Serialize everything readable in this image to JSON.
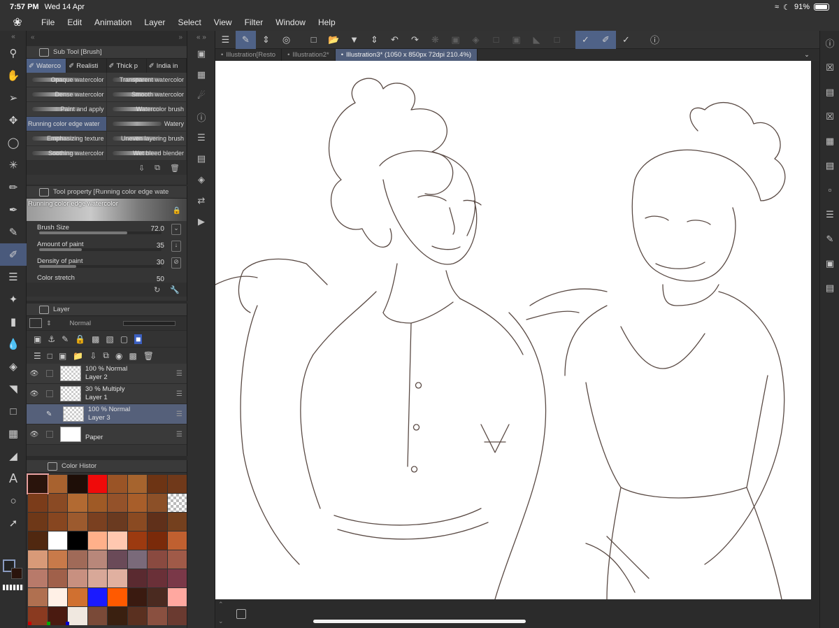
{
  "status": {
    "time": "7:57 PM",
    "date": "Wed 14 Apr",
    "battery": "91%"
  },
  "menu": [
    "File",
    "Edit",
    "Animation",
    "Layer",
    "Select",
    "View",
    "Filter",
    "Window",
    "Help"
  ],
  "subtool": {
    "panel_title": "Sub Tool [Brush]",
    "tabs": [
      {
        "label": "Waterco",
        "active": true
      },
      {
        "label": "Realisti",
        "active": false
      },
      {
        "label": "Thick p",
        "active": false
      },
      {
        "label": "India in",
        "active": false
      }
    ],
    "brushes": [
      {
        "label": "Opaque watercolor",
        "selected": false
      },
      {
        "label": "Transparent watercolor",
        "selected": false
      },
      {
        "label": "Dense watercolor",
        "selected": false
      },
      {
        "label": "Smooth watercolor",
        "selected": false
      },
      {
        "label": "Paint and apply",
        "selected": false
      },
      {
        "label": "Watercolor brush",
        "selected": false
      },
      {
        "label": "Running color edge water",
        "selected": true
      },
      {
        "label": "Watery",
        "selected": false
      },
      {
        "label": "Emphasizing texture",
        "selected": false
      },
      {
        "label": "Uneven layering brush",
        "selected": false
      },
      {
        "label": "Soothing watercolor",
        "selected": false
      },
      {
        "label": "Wet bleed blender",
        "selected": false
      }
    ]
  },
  "toolprop": {
    "panel_title": "Tool property [Running color edge wate",
    "brush_name": "Running color edge watercolor",
    "rows": [
      {
        "label": "Brush Size",
        "value": "72.0",
        "level": 0.72
      },
      {
        "label": "Amount of paint",
        "value": "35",
        "level": 0.35
      },
      {
        "label": "Density of paint",
        "value": "30",
        "level": 0.3
      },
      {
        "label": "Color stretch",
        "value": "50",
        "level": 0.5
      }
    ]
  },
  "layers": {
    "panel_title": "Layer",
    "blend_mode": "Normal",
    "items": [
      {
        "opacity_mode": "100 % Normal",
        "name": "Layer 2",
        "selected": false,
        "visible": true,
        "white": false
      },
      {
        "opacity_mode": "30 % Multiply",
        "name": "Layer 1",
        "selected": false,
        "visible": true,
        "white": false
      },
      {
        "opacity_mode": "100 % Normal",
        "name": "Layer 3",
        "selected": true,
        "visible": false,
        "white": false
      },
      {
        "opacity_mode": "",
        "name": "Paper",
        "selected": false,
        "visible": true,
        "white": true
      }
    ]
  },
  "color_history": {
    "panel_title": "Color Histor",
    "swatches": [
      "#2a140c",
      "#a8622f",
      "#1e0e07",
      "#f00a0a",
      "#9a5426",
      "#a6642e",
      "#6d3414",
      "#70391a",
      "#7b3c1a",
      "#8a4a24",
      "#b26a32",
      "#9f5a26",
      "#94522a",
      "#a85e2a",
      "#8c5028",
      "#checker",
      "#6e3818",
      "#874620",
      "#9c5a2e",
      "#7a4020",
      "#6a3a20",
      "#8a4a22",
      "#60301a",
      "#74401e",
      "#502810",
      "#ffffff",
      "#000000",
      "#ffb08a",
      "#ffc8b0",
      "#9c3a10",
      "#7a2a0a",
      "#c06030",
      "#d89a78",
      "#c87a4a",
      "#a06a58",
      "#b8877a",
      "#6a4a58",
      "#7a6a7a",
      "#8a4a40",
      "#a05a48",
      "#b87a6a",
      "#a0604a",
      "#c89080",
      "#d8a898",
      "#e0b0a0",
      "#5a2a30",
      "#6a3038",
      "#7a3848",
      "#b07050",
      "#fff0e6",
      "#d07030",
      "#1a1aff",
      "#ff5a00",
      "#3a1a10",
      "#4a2a20",
      "#ffa8a0",
      "#8a3a20",
      "#4a1a10",
      "#f0e8e0",
      "#7a4a38",
      "#3a2010",
      "#5a3020",
      "#8a5040",
      "#6a3a30"
    ]
  },
  "doc_tabs": [
    {
      "label": "Illustration[Resto",
      "active": false
    },
    {
      "label": "Illustration2*",
      "active": false
    },
    {
      "label": "Illustration3* (1050 x 850px 72dpi 210.4%)",
      "active": true
    }
  ],
  "colors": {
    "accent": "#4f6287",
    "canvas": "#ffffff",
    "sketch": "#5a4a44"
  }
}
